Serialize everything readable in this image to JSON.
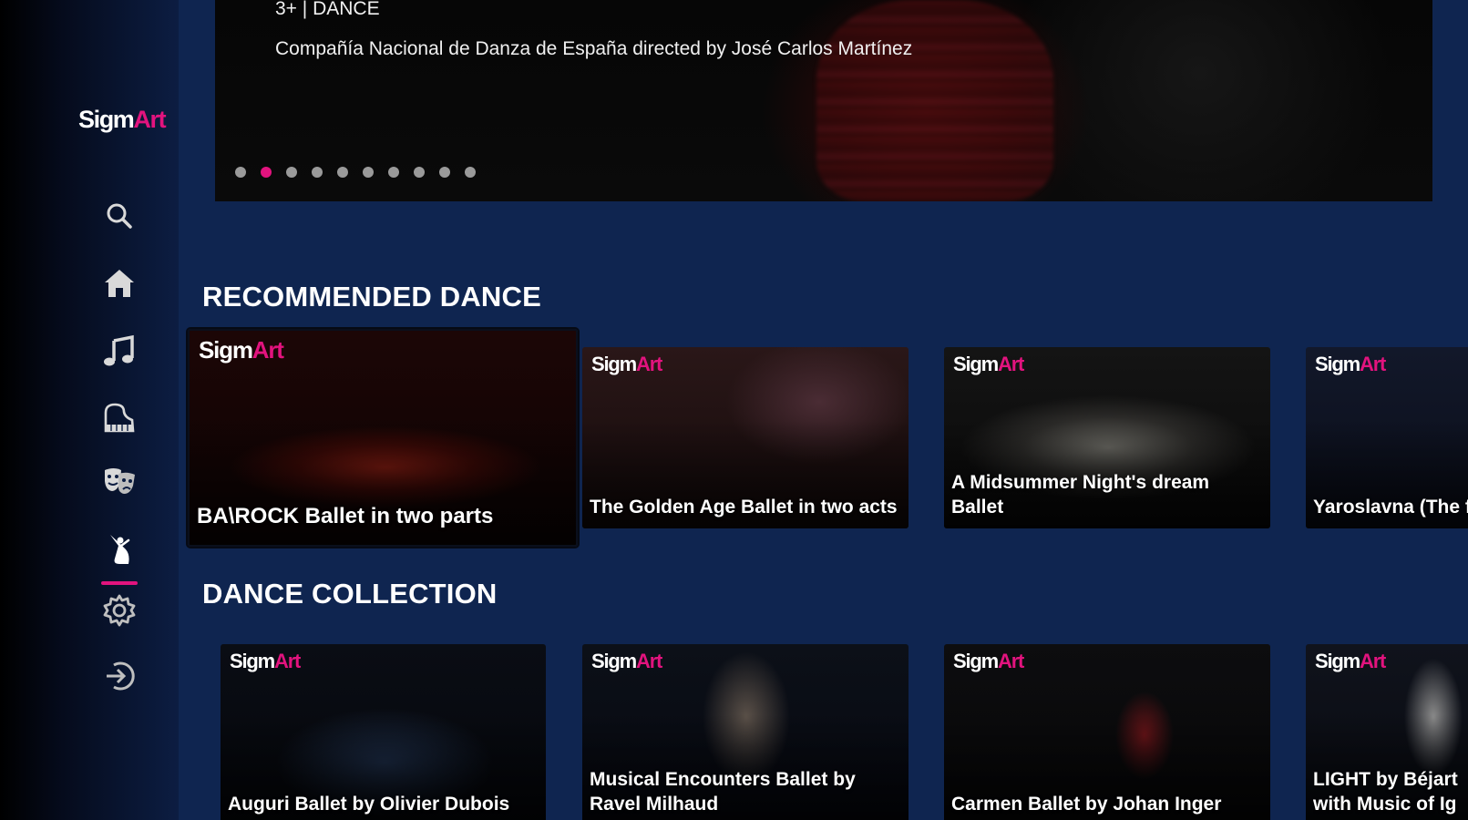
{
  "app": {
    "logo_left": "Sigm",
    "logo_right": "Art"
  },
  "sidebar": {
    "items": [
      {
        "icon": "search-icon"
      },
      {
        "icon": "home-icon"
      },
      {
        "icon": "music-note-icon"
      },
      {
        "icon": "piano-icon"
      },
      {
        "icon": "theater-masks-icon"
      },
      {
        "icon": "dance-icon",
        "active": true
      },
      {
        "icon": "gear-icon"
      },
      {
        "icon": "logout-icon"
      }
    ]
  },
  "hero": {
    "meta": "3+ | DANCE",
    "description": "Compañía Nacional de Danza de España directed by José Carlos Martínez",
    "carousel": {
      "count": 10,
      "active_index": 1
    }
  },
  "sections": [
    {
      "title": "RECOMMENDED DANCE",
      "cards": [
        {
          "brand_left": "Sigm",
          "brand_right": "Art",
          "title": "BA\\ROCK Ballet in two parts"
        },
        {
          "brand_left": "Sigm",
          "brand_right": "Art",
          "title": "The Golden Age Ballet in two acts"
        },
        {
          "brand_left": "Sigm",
          "brand_right": "Art",
          "title": "A Midsummer Night's dream Ballet"
        },
        {
          "brand_left": "Sigm",
          "brand_right": "Art",
          "title": "Yaroslavna (The from Mariinsky T"
        }
      ]
    },
    {
      "title": "DANCE COLLECTION",
      "cards": [
        {
          "brand_left": "Sigm",
          "brand_right": "Art",
          "title": "Auguri Ballet by Olivier Dubois"
        },
        {
          "brand_left": "Sigm",
          "brand_right": "Art",
          "title": "Musical Encounters Ballet by Ravel Milhaud"
        },
        {
          "brand_left": "Sigm",
          "brand_right": "Art",
          "title": "Carmen Ballet by  Johan Inger"
        },
        {
          "brand_left": "Sigm",
          "brand_right": "Art",
          "title": "LIGHT by Béjart with Music of Ig"
        }
      ]
    }
  ],
  "colors": {
    "accent": "#e2137e",
    "background": "#0f2550"
  }
}
